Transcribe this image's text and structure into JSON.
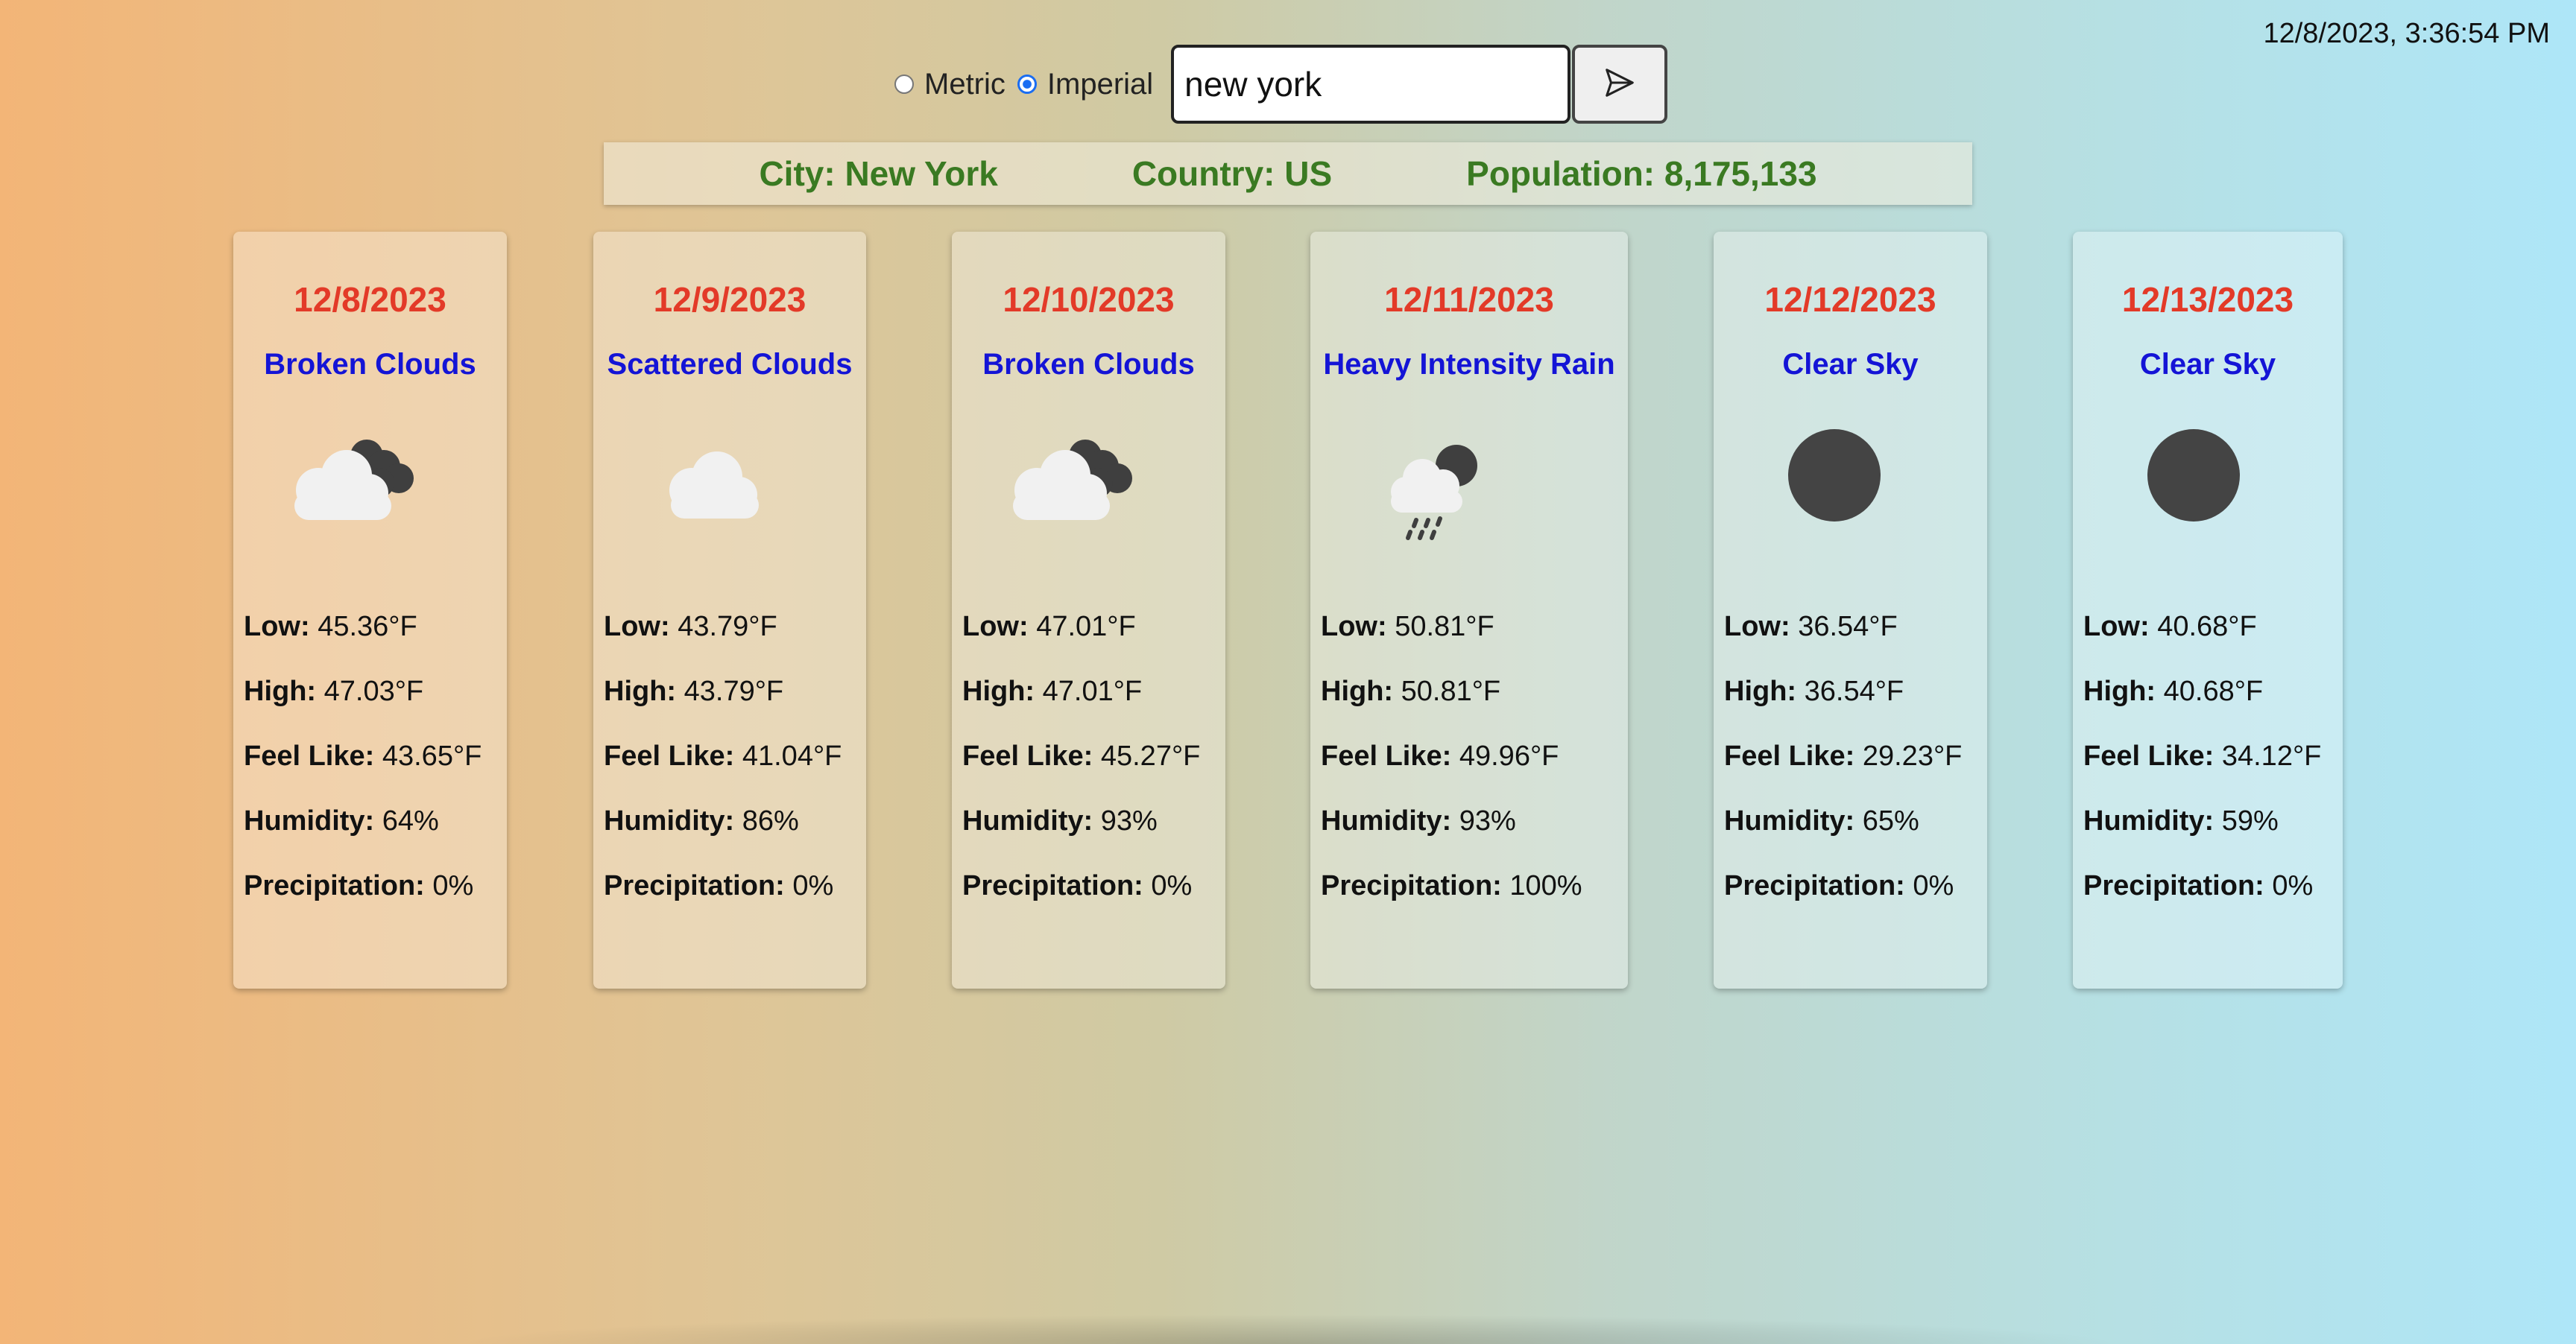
{
  "datetime": "12/8/2023, 3:36:54 PM",
  "units": {
    "metric_label": "Metric",
    "imperial_label": "Imperial",
    "selected": "Imperial"
  },
  "search": {
    "value": "new york"
  },
  "location": {
    "city": "City: New York",
    "country": "Country: US",
    "population": "Population: 8,175,133"
  },
  "labels": {
    "low": "Low:",
    "high": "High:",
    "feel": "Feel Like:",
    "humidity": "Humidity:",
    "precip": "Precipitation:"
  },
  "forecast": [
    {
      "date": "12/8/2023",
      "desc": "Broken Clouds",
      "icon": "broken-clouds-icon",
      "low": "45.36°F",
      "high": "47.03°F",
      "feel": "43.65°F",
      "humidity": "64%",
      "precip": "0%"
    },
    {
      "date": "12/9/2023",
      "desc": "Scattered Clouds",
      "icon": "scattered-clouds-icon",
      "low": "43.79°F",
      "high": "43.79°F",
      "feel": "41.04°F",
      "humidity": "86%",
      "precip": "0%"
    },
    {
      "date": "12/10/2023",
      "desc": "Broken Clouds",
      "icon": "broken-clouds-icon",
      "low": "47.01°F",
      "high": "47.01°F",
      "feel": "45.27°F",
      "humidity": "93%",
      "precip": "0%"
    },
    {
      "date": "12/11/2023",
      "desc": "Heavy Intensity Rain",
      "icon": "rain-icon",
      "low": "50.81°F",
      "high": "50.81°F",
      "feel": "49.96°F",
      "humidity": "93%",
      "precip": "100%"
    },
    {
      "date": "12/12/2023",
      "desc": "Clear Sky",
      "icon": "clear-sky-icon",
      "low": "36.54°F",
      "high": "36.54°F",
      "feel": "29.23°F",
      "humidity": "65%",
      "precip": "0%"
    },
    {
      "date": "12/13/2023",
      "desc": "Clear Sky",
      "icon": "clear-sky-icon",
      "low": "40.68°F",
      "high": "40.68°F",
      "feel": "34.12°F",
      "humidity": "59%",
      "precip": "0%"
    }
  ],
  "colors": {
    "date": "#e33a28",
    "desc": "#1414d6",
    "location": "#3a7a22"
  }
}
